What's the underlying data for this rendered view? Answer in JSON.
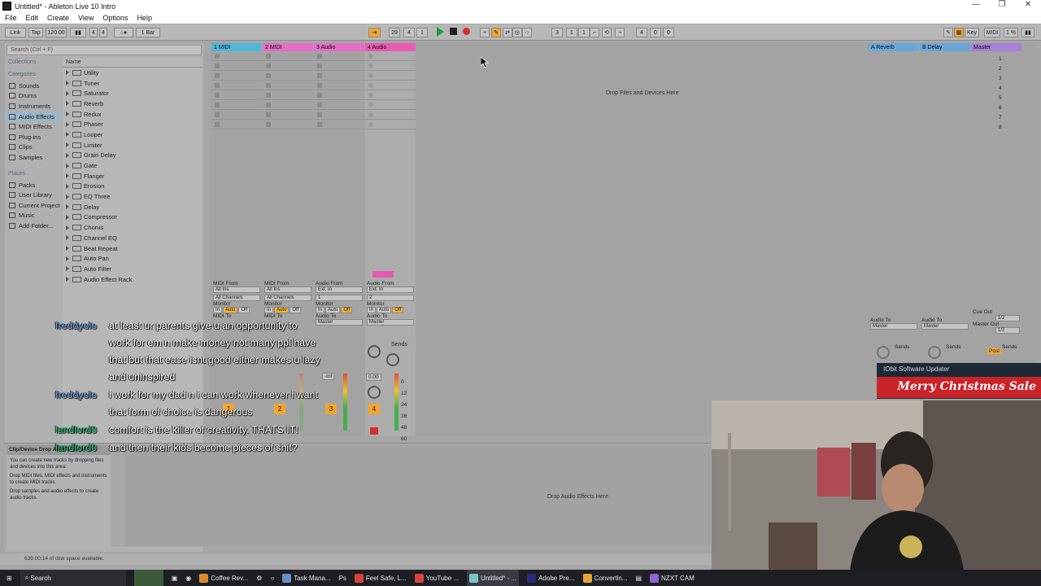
{
  "window": {
    "title": "Untitled* - Ableton Live 10 Intro",
    "controls": [
      "—",
      "❐",
      "✕"
    ]
  },
  "menu": [
    "File",
    "Edit",
    "Create",
    "View",
    "Options",
    "Help"
  ],
  "control_bar": {
    "link": "Link",
    "tap": "Tap",
    "tempo": "120.00",
    "sig_num": "4",
    "sig_den": "4",
    "quantize": "1 Bar",
    "position": [
      "29",
      "4",
      "1"
    ],
    "loop_start": [
      "3",
      "1",
      "1"
    ],
    "loop_length": [
      "4",
      "0",
      "0"
    ],
    "key": "Key",
    "midi": "MIDI",
    "cpu": "1 %"
  },
  "browser": {
    "search_placeholder": "Search (Ctrl + F)",
    "collections_header": "Collections",
    "categories_header": "Categories",
    "categories": [
      "Sounds",
      "Drums",
      "Instruments",
      "Audio Effects",
      "MIDI Effects",
      "Plug-ins",
      "Clips",
      "Samples"
    ],
    "selected_category": "Audio Effects",
    "places_header": "Places",
    "places": [
      "Packs",
      "User Library",
      "Current Project",
      "Music",
      "Add Folder..."
    ],
    "name_header": "Name",
    "items": [
      "Utility",
      "Tuner",
      "Saturator",
      "Reverb",
      "Redux",
      "Phaser",
      "Looper",
      "Limiter",
      "Grain Delay",
      "Gate",
      "Flanger",
      "Erosion",
      "EQ Three",
      "Delay",
      "Compressor",
      "Chorus",
      "Channel EQ",
      "Beat Repeat",
      "Auto Pan",
      "Auto Filter",
      "Audio Effect Rack"
    ]
  },
  "tracks": [
    {
      "name": "1 MIDI",
      "color": "#4fb8d8",
      "from_label": "MIDI From",
      "from": "All Ins",
      "channel": "All Channels",
      "to_label": "MIDI To",
      "number": "1"
    },
    {
      "name": "2 MIDI",
      "color": "#e46ec8",
      "from_label": "MIDI From",
      "from": "All Ins",
      "channel": "All Channels",
      "to_label": "MIDI To",
      "number": "2"
    },
    {
      "name": "3 Audio",
      "color": "#e46ec8",
      "from_label": "Audio From",
      "from": "Ext. In",
      "channel": "1",
      "to_label": "Audio To",
      "to": "Master",
      "number": "3"
    },
    {
      "name": "4 Audio",
      "color": "#e85ab0",
      "from_label": "Audio From",
      "from": "Ext. In",
      "channel": "2",
      "to_label": "Audio To",
      "to": "Master",
      "number": "4"
    }
  ],
  "monitor": {
    "label": "Monitor",
    "options": [
      "In",
      "Auto",
      "Off"
    ]
  },
  "sends_label": "Sends",
  "volume_readout": "0.00",
  "inf_readout": "-Inf",
  "db_scale": [
    "0",
    "12",
    "24",
    "36",
    "48",
    "60"
  ],
  "returns": [
    {
      "name": "A Reverb",
      "color": "#6aa7d8",
      "to_label": "Audio To",
      "to": "Master"
    },
    {
      "name": "B Delay",
      "color": "#6aa7d8",
      "to_label": "Audio To",
      "to": "Master"
    }
  ],
  "master": {
    "name": "Master",
    "color": "#a67fd8",
    "scenes": [
      "1",
      "2",
      "3",
      "4",
      "5",
      "6",
      "7",
      "8"
    ],
    "cue_label": "Cue Out",
    "cue": "1/2",
    "out_label": "Master Out",
    "out": "1/2",
    "post": "Post"
  },
  "drop_message": "Drop Files and Devices Here",
  "detail": {
    "help_title": "Clip/Device Drop Area",
    "help_lines": [
      "You can create new tracks by dropping files and devices into this area:",
      "Drop MIDI files, MIDI effects and instruments to create MIDI tracks.",
      "Drop samples and audio effects to create audio tracks."
    ],
    "drop_effects": "Drop Audio Effects Here"
  },
  "status": "639:00:14 of disk space available.",
  "chat": [
    {
      "user": "freddyolo",
      "color": "blue",
      "lines": [
        "at least ur parents give u an opportunity to",
        "work for em n make money not many ppl have",
        "that but that ease isnt good either makes u lazy",
        "and uninspired"
      ]
    },
    {
      "user": "freddyolo",
      "color": "blue",
      "lines": [
        "i work for my dad n i can work whenever i want",
        "that form of choice is dangerous"
      ]
    },
    {
      "user": "landlord0",
      "color": "green",
      "lines": [
        "comfort is the killer of creativity. THATS IT!"
      ]
    },
    {
      "user": "landlord0",
      "color": "green",
      "lines": [
        "and then their kids become pieces of shit?"
      ]
    }
  ],
  "popup": {
    "title": "IObit Software Updater",
    "banner": "Merry Christmas Sale"
  },
  "taskbar": {
    "search": "Search",
    "apps": [
      {
        "label": "Coffee Rev...",
        "color": "#d98b2c"
      },
      {
        "label": "Task Mana...",
        "color": "#6c8fc6"
      },
      {
        "label": "Feel Safe, L...",
        "color": "#d6453d"
      },
      {
        "label": "YouTube ...",
        "color": "#d6453d"
      },
      {
        "label": "Untitled* - ...",
        "color": "#7bc6c3"
      },
      {
        "label": "Adobe Pre...",
        "color": "#2a2a7a"
      },
      {
        "label": "Convertin...",
        "color": "#e8a23a"
      },
      {
        "label": "NZXT CAM",
        "color": "#8f66d2"
      }
    ]
  }
}
